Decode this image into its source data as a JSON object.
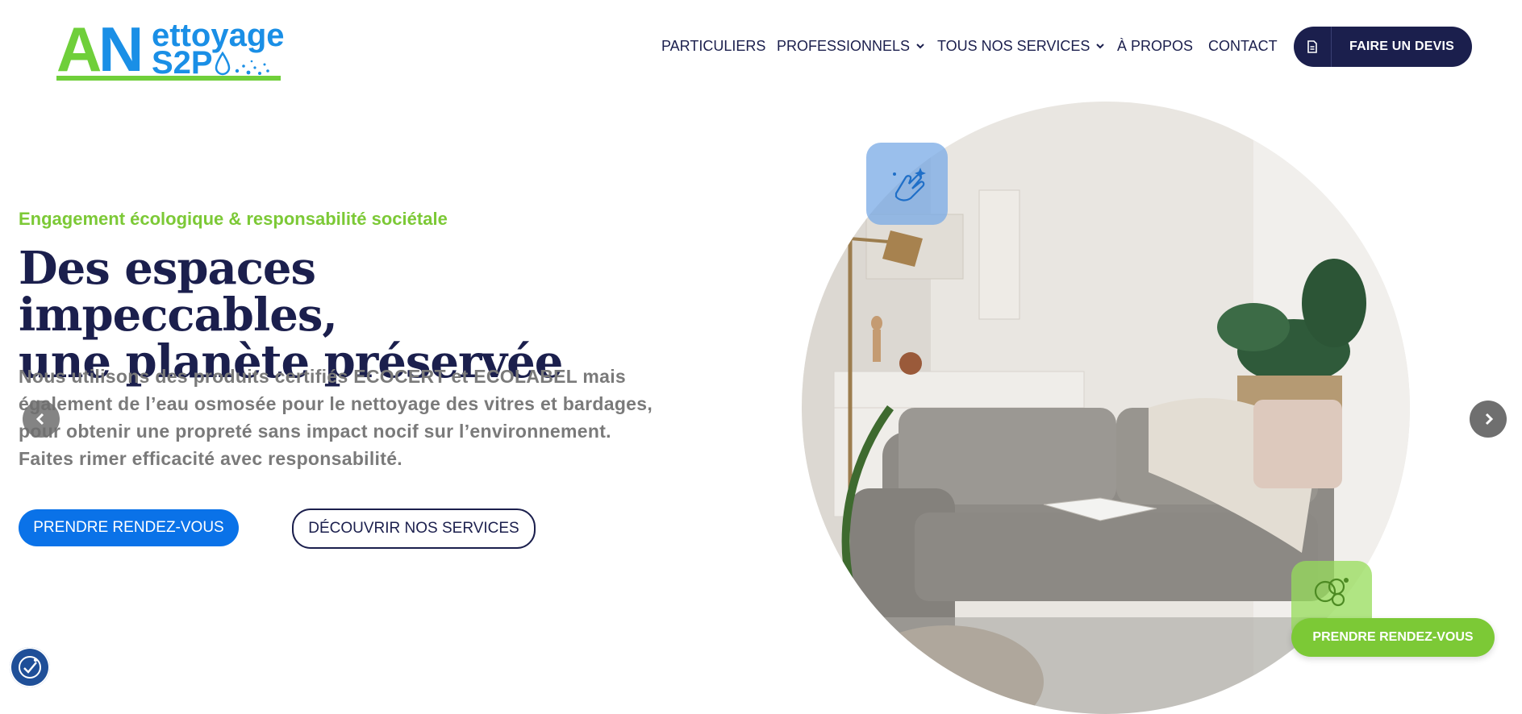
{
  "logo": {
    "letter_a": "A",
    "letter_n": "N",
    "word1": "ettoyage",
    "word2": "S2P",
    "colors": {
      "green": "#6fcf3a",
      "blue": "#1a8fe6"
    }
  },
  "nav": {
    "items": [
      {
        "label": "PARTICULIERS",
        "has_dropdown": false
      },
      {
        "label": "PROFESSIONNELS",
        "has_dropdown": true
      },
      {
        "label": "TOUS NOS SERVICES",
        "has_dropdown": true
      },
      {
        "label": "À PROPOS",
        "has_dropdown": false
      },
      {
        "label": "CONTACT",
        "has_dropdown": false
      }
    ],
    "cta": {
      "label": "FAIRE UN DEVIS",
      "icon": "document-icon"
    }
  },
  "hero": {
    "eyebrow": "Engagement écologique & responsabilité sociétale",
    "title_line1": "Des espaces impeccables,",
    "title_line2": "une planète préservée",
    "lead": "Nous utilisons des produits certifiés ECOCERT et ECOLABEL mais également de l’eau osmosée pour le nettoyage des vitres et bardages, pour obtenir une propreté sans impact nocif sur l’environnement. Faites rimer efficacité avec responsabilité.",
    "primary_button": "PRENDRE RENDEZ-VOUS",
    "secondary_button": "DÉCOUVRIR NOS SERVICES"
  },
  "carousel": {
    "prev_icon": "chevron-left-icon",
    "next_icon": "chevron-right-icon"
  },
  "floating": {
    "appointment_button": "PRENDRE RENDEZ-VOUS"
  },
  "accessibility": {
    "icon": "accessibility-icon"
  },
  "colors": {
    "navy": "#1b1f4d",
    "green": "#7cc936",
    "blue": "#0a72e8",
    "grey_text": "#7a7a7a"
  }
}
